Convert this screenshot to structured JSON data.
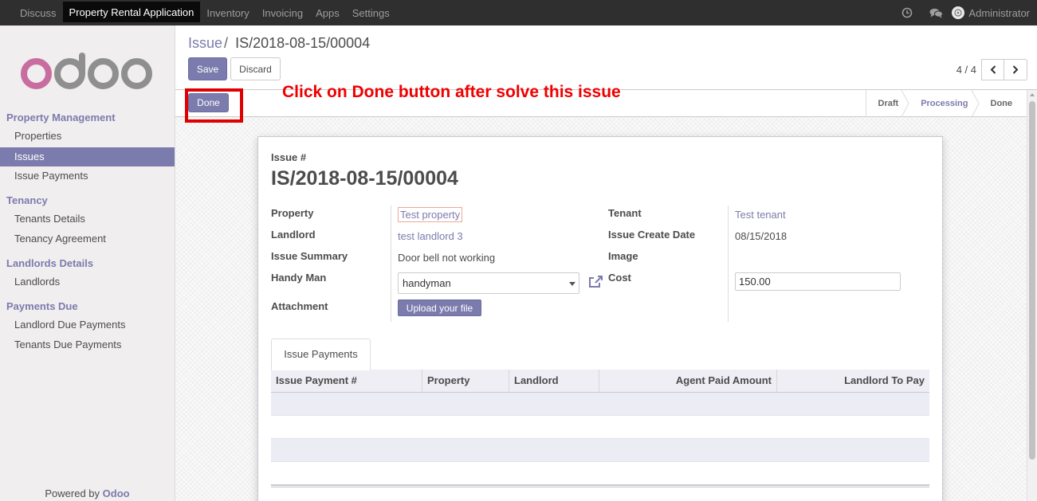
{
  "topbar": {
    "menu": [
      "Discuss",
      "Property Rental Application",
      "Inventory",
      "Invoicing",
      "Apps",
      "Settings"
    ],
    "active_index": 1,
    "user": "Administrator",
    "icons": [
      "clock-icon",
      "chat-icon",
      "avatar"
    ]
  },
  "sidebar": {
    "logo_text": "odoo",
    "sections": [
      {
        "title": "Property Management",
        "items": [
          "Properties",
          "Issues",
          "Issue Payments"
        ]
      },
      {
        "title": "Tenancy",
        "items": [
          "Tenants Details",
          "Tenancy Agreement"
        ]
      },
      {
        "title": "Landlords Details",
        "items": [
          "Landlords"
        ]
      },
      {
        "title": "Payments Due",
        "items": [
          "Landlord Due Payments",
          "Tenants Due Payments"
        ]
      }
    ],
    "active_item": "Issues",
    "powered_prefix": "Powered by",
    "powered_brand": "Odoo"
  },
  "control": {
    "breadcrumb_parent": "Issue",
    "breadcrumb_sep": "/",
    "breadcrumb_current": "IS/2018-08-15/00004",
    "save_label": "Save",
    "discard_label": "Discard",
    "pager_value": "4 / 4"
  },
  "statusbar": {
    "done_label": "Done",
    "annotation": "Click on Done button after solve this issue",
    "stages": [
      "Draft",
      "Processing",
      "Done"
    ],
    "current_stage": "Processing"
  },
  "form": {
    "issue_no_label": "Issue #",
    "issue_no": "IS/2018-08-15/00004",
    "property_label": "Property",
    "property_value": "Test property",
    "landlord_label": "Landlord",
    "landlord_value": "test landlord 3",
    "summary_label": "Issue Summary",
    "summary_value": "Door bell not working",
    "handyman_label": "Handy Man",
    "handyman_value": "handyman",
    "attachment_label": "Attachment",
    "upload_label": "Upload your file",
    "tenant_label": "Tenant",
    "tenant_value": "Test tenant",
    "create_date_label": "Issue Create Date",
    "create_date_value": "08/15/2018",
    "image_label": "Image",
    "cost_label": "Cost",
    "cost_value": "150.00"
  },
  "payments": {
    "tab_label": "Issue Payments",
    "columns": [
      "Issue Payment #",
      "Property",
      "Landlord",
      "Agent Paid Amount",
      "Landlord To Pay"
    ],
    "rows": []
  },
  "colors": {
    "accent": "#7c7bad",
    "highlight": "#e10000",
    "annotation": "#ef0000",
    "navbar": "#2f2f2f"
  }
}
